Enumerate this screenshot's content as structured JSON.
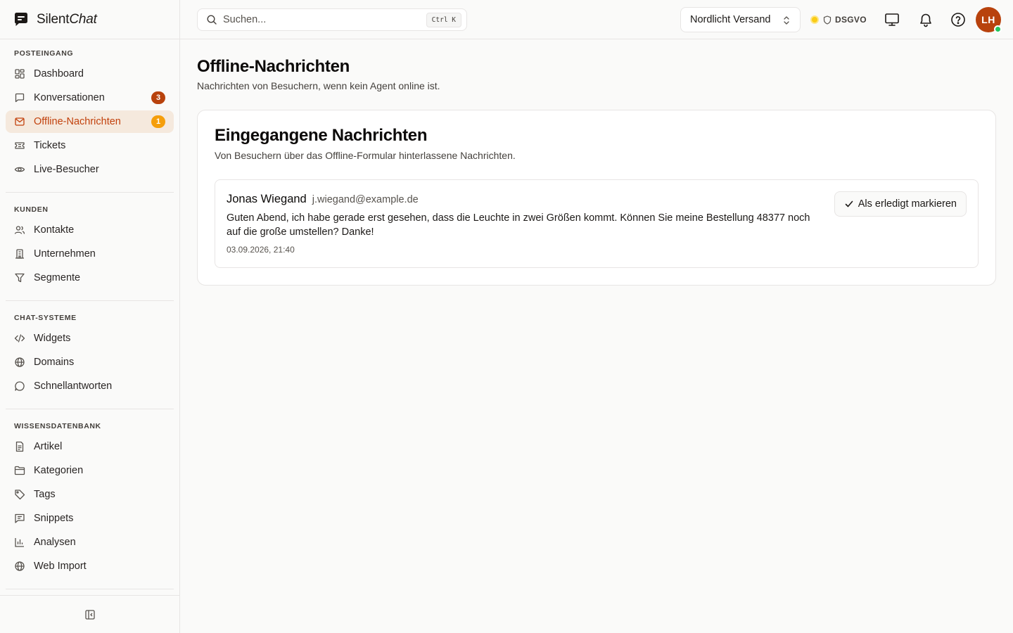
{
  "brand": {
    "name_plain": "Silent",
    "name_italic": "Chat"
  },
  "search": {
    "placeholder": "Suchen...",
    "shortcut": "Ctrl K"
  },
  "header": {
    "workspace": "Nordlicht Versand",
    "compliance": "DSGVO",
    "avatar_initials": "LH",
    "icons": [
      "monitor-icon",
      "bell-icon",
      "help-icon"
    ]
  },
  "sidebar": {
    "sections": [
      {
        "heading": "POSTEINGANG",
        "items": [
          {
            "label": "Dashboard",
            "icon": "dashboard-icon"
          },
          {
            "label": "Konversationen",
            "icon": "chat-icon",
            "badge": "3"
          },
          {
            "label": "Offline-Nachrichten",
            "icon": "mail-icon",
            "badge": "1",
            "active": true
          },
          {
            "label": "Tickets",
            "icon": "ticket-icon"
          },
          {
            "label": "Live-Besucher",
            "icon": "eye-icon"
          }
        ]
      },
      {
        "heading": "KUNDEN",
        "items": [
          {
            "label": "Kontakte",
            "icon": "users-icon"
          },
          {
            "label": "Unternehmen",
            "icon": "building-icon"
          },
          {
            "label": "Segmente",
            "icon": "filter-icon"
          }
        ]
      },
      {
        "heading": "CHAT-SYSTEME",
        "items": [
          {
            "label": "Widgets",
            "icon": "code-icon"
          },
          {
            "label": "Domains",
            "icon": "globe-icon"
          },
          {
            "label": "Schnellantworten",
            "icon": "message-circle-icon"
          }
        ]
      },
      {
        "heading": "WISSENSDATENBANK",
        "items": [
          {
            "label": "Artikel",
            "icon": "file-text-icon"
          },
          {
            "label": "Kategorien",
            "icon": "folder-icon"
          },
          {
            "label": "Tags",
            "icon": "tag-icon"
          },
          {
            "label": "Snippets",
            "icon": "message-square-icon"
          },
          {
            "label": "Analysen",
            "icon": "bar-chart-icon"
          },
          {
            "label": "Web Import",
            "icon": "globe-icon"
          }
        ]
      }
    ]
  },
  "page": {
    "title": "Offline-Nachrichten",
    "subtitle": "Nachrichten von Besuchern, wenn kein Agent online ist."
  },
  "card": {
    "title": "Eingegangene Nachrichten",
    "subtitle": "Von Besuchern über das Offline-Formular hinterlassene Nachrichten.",
    "messages": [
      {
        "name": "Jonas Wiegand",
        "email": "j.wiegand@example.de",
        "body": "Guten Abend, ich habe gerade erst gesehen, dass die Leuchte in zwei Größen kommt. Können Sie meine Bestellung 48377 noch auf die große umstellen? Danke!",
        "time": "03.09.2026, 21:40",
        "action_label": "Als erledigt markieren"
      }
    ]
  },
  "colors": {
    "accent": "#c2410c",
    "accent_bg": "#f5e9dd",
    "badge_red": "#b8420d",
    "badge_amber": "#f59e0b",
    "online": "#22c55e"
  }
}
